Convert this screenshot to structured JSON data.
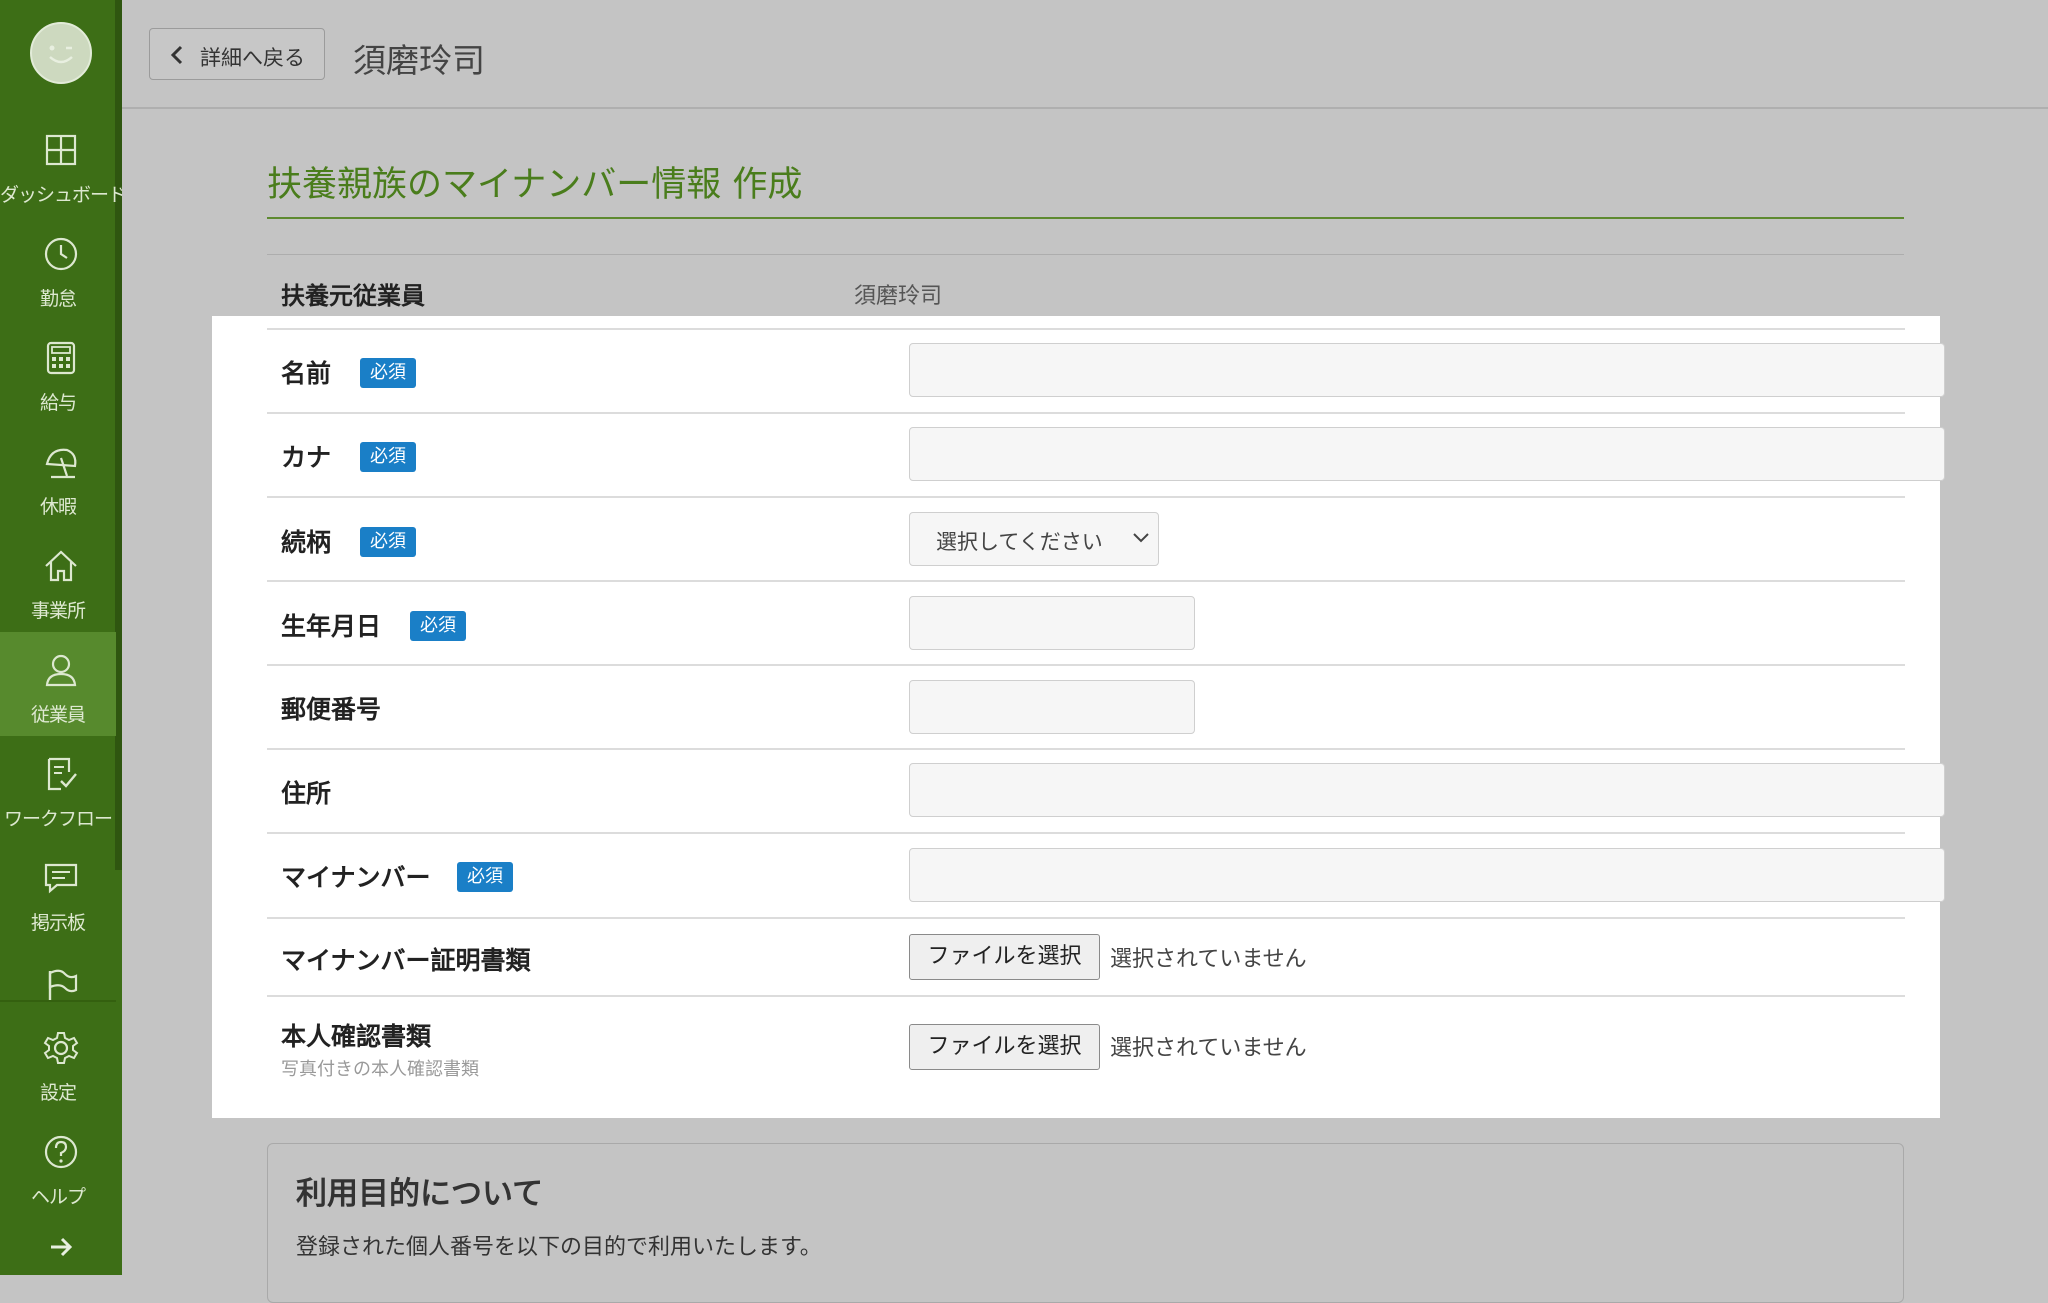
{
  "sidebar": {
    "items": [
      {
        "label": "ダッシュボード",
        "icon": "dashboard-icon"
      },
      {
        "label": "勤怠",
        "icon": "clock-icon"
      },
      {
        "label": "給与",
        "icon": "calculator-icon"
      },
      {
        "label": "休暇",
        "icon": "beach-umbrella-icon"
      },
      {
        "label": "事業所",
        "icon": "home-icon"
      },
      {
        "label": "従業員",
        "icon": "user-icon"
      },
      {
        "label": "ワークフロー",
        "icon": "checklist-icon"
      },
      {
        "label": "掲示板",
        "icon": "message-icon"
      },
      {
        "label": "",
        "icon": "flag-icon"
      },
      {
        "label": "設定",
        "icon": "gear-icon"
      },
      {
        "label": "ヘルプ",
        "icon": "help-icon"
      }
    ],
    "active_item": "従業員",
    "colors": {
      "background": "#3d6e16",
      "active": "#578a2d"
    }
  },
  "header": {
    "back_label": "詳細へ戻る",
    "title": "須磨玲司"
  },
  "form": {
    "heading": "扶養親族のマイナンバー情報 作成",
    "employee_label": "扶養元従業員",
    "employee_value": "須磨玲司",
    "required_badge": "必須",
    "fields": {
      "name": "名前",
      "kana": "カナ",
      "relation": "続柄",
      "relation_selected": "選択してください",
      "birthdate": "生年月日",
      "postal": "郵便番号",
      "address": "住所",
      "mynumber": "マイナンバー",
      "mynumber_doc": "マイナンバー証明書類",
      "identity_doc": "本人確認書類",
      "identity_doc_hint": "写真付きの本人確認書類"
    },
    "file_button_label": "ファイルを選択",
    "file_status": "選択されていません",
    "colors": {
      "heading": "#4a7d1c",
      "badge": "#1a7fc7"
    }
  },
  "purpose": {
    "title": "利用目的について",
    "text": "登録された個人番号を以下の目的で利用いたします。"
  }
}
